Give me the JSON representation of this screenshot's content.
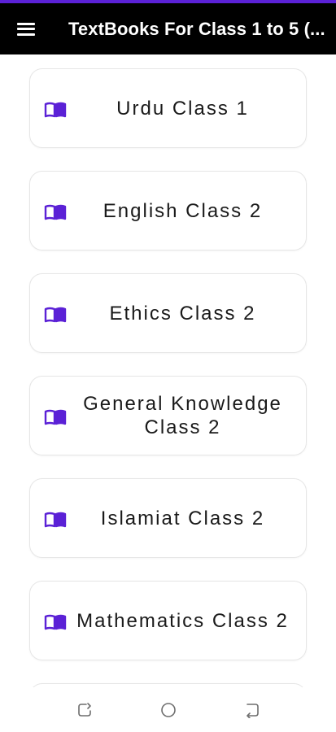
{
  "app_bar": {
    "title": "TextBooks For Class 1 to 5 (...",
    "menu_icon": "hamburger-menu-icon",
    "background": "#000000",
    "accent": "#5b21d6"
  },
  "books": [
    {
      "label": "Urdu Class 1",
      "icon": "open-book-icon"
    },
    {
      "label": "English Class 2",
      "icon": "open-book-icon"
    },
    {
      "label": "Ethics Class 2",
      "icon": "open-book-icon"
    },
    {
      "label": "General Knowledge Class 2",
      "icon": "open-book-icon"
    },
    {
      "label": "Islamiat Class 2",
      "icon": "open-book-icon"
    },
    {
      "label": "Mathematics Class 2",
      "icon": "open-book-icon"
    }
  ],
  "icon_color": "#5b21d6",
  "nav_bar": {
    "items": [
      "recents-icon",
      "home-icon",
      "back-icon"
    ]
  }
}
